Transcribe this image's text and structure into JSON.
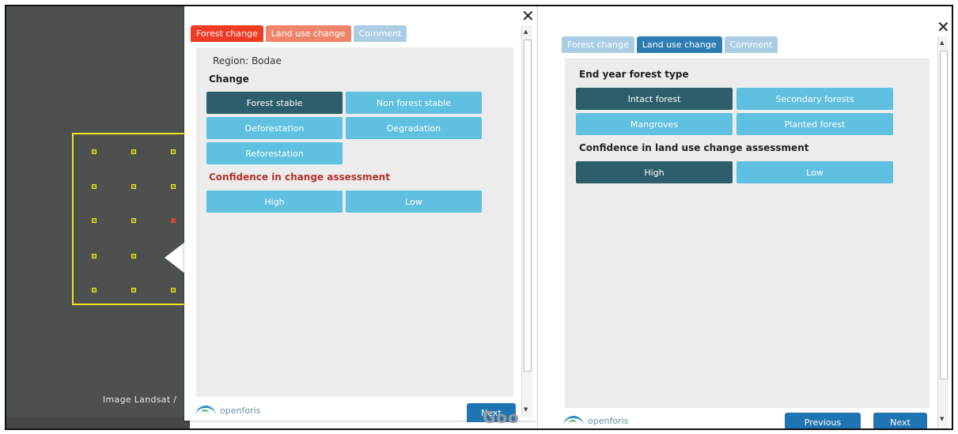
{
  "left_panel": {
    "tabs": [
      {
        "label": "Forest change"
      },
      {
        "label": "Land use change"
      },
      {
        "label": "Comment"
      }
    ],
    "region_label": "Region: Bodae",
    "change_heading": "Change",
    "change_options": [
      {
        "label": "Forest stable"
      },
      {
        "label": "Non forest stable"
      },
      {
        "label": "Deforestation"
      },
      {
        "label": "Degradation"
      },
      {
        "label": "Reforestation"
      }
    ],
    "confidence_heading": "Confidence in change assessment",
    "confidence_options": [
      {
        "label": "High"
      },
      {
        "label": "Low"
      }
    ],
    "next_label": "Next",
    "logo_text": "openforis",
    "close_glyph": "✕"
  },
  "right_panel": {
    "tabs": [
      {
        "label": "Forest change"
      },
      {
        "label": "Land use change"
      },
      {
        "label": "Comment"
      }
    ],
    "forest_type_heading": "End year forest type",
    "forest_type_options": [
      {
        "label": "Intact forest"
      },
      {
        "label": "Secondary forests"
      },
      {
        "label": "Mangroves"
      },
      {
        "label": "Planted forest"
      }
    ],
    "confidence_heading": "Confidence in land use change assessment",
    "confidence_options": [
      {
        "label": "High"
      },
      {
        "label": "Low"
      }
    ],
    "previous_label": "Previous",
    "next_label": "Next",
    "logo_text": "openforis",
    "close_glyph": "✕"
  },
  "map": {
    "credit": "Image Landsat /",
    "watermark": "Goo"
  },
  "colors": {
    "selected": "#2c5e6c",
    "option": "#5fc0e0",
    "tab_active_red": "#ee3b23",
    "tab_active_blue": "#2d7db4",
    "plot_outline": "#f2e41b"
  }
}
